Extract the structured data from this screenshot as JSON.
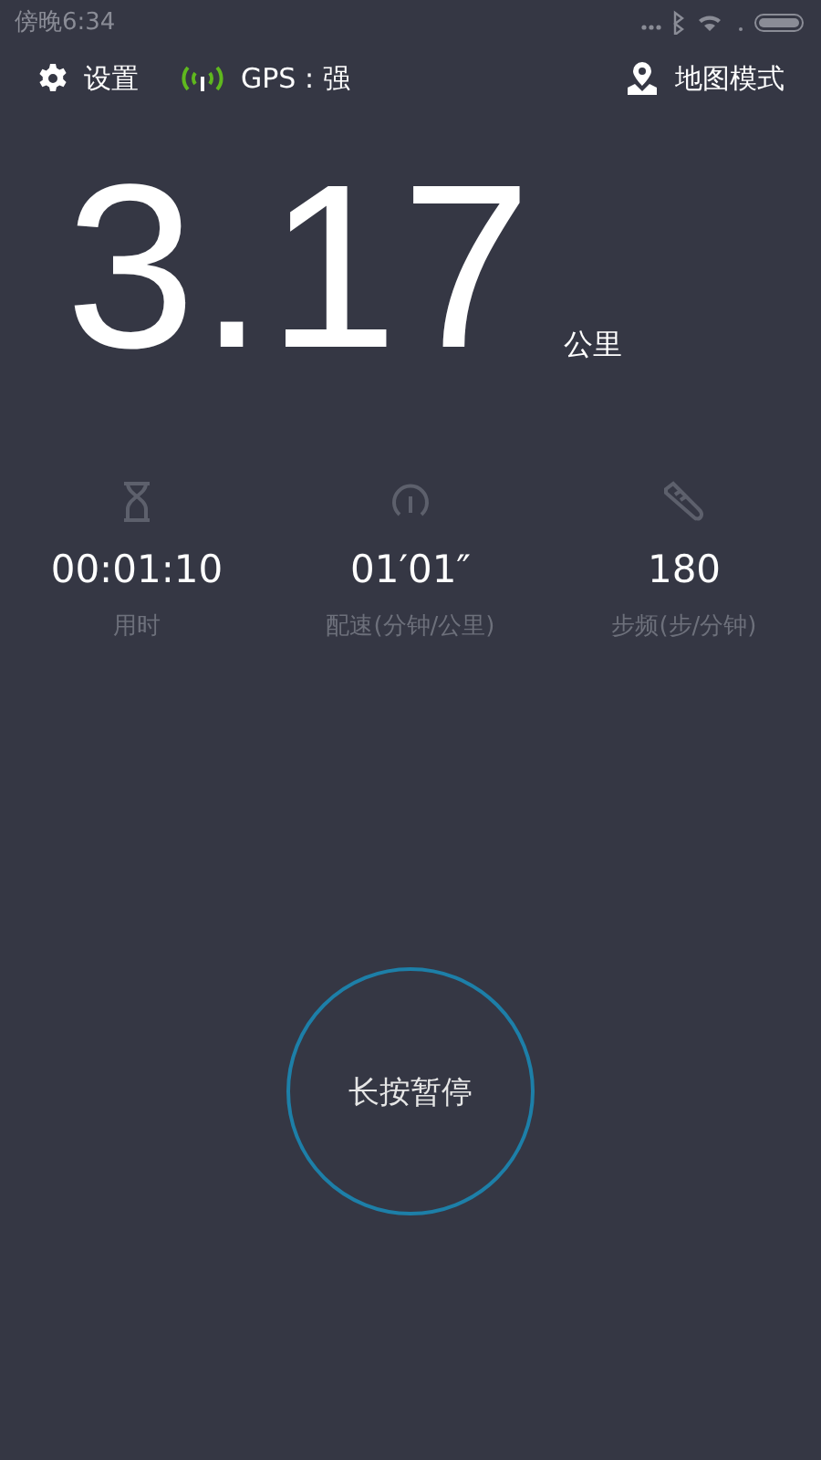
{
  "status_bar": {
    "time": "傍晚6:34"
  },
  "toolbar": {
    "settings": "设置",
    "gps": "GPS : 强",
    "map_mode": "地图模式"
  },
  "distance": {
    "value": "3.17",
    "unit": "公里"
  },
  "stats": [
    {
      "kind": "time",
      "value": "00:01:10",
      "label": "用时"
    },
    {
      "kind": "pace",
      "value": "01′01″",
      "label": "配速(分钟/公里)"
    },
    {
      "kind": "cadence",
      "value": "180",
      "label": "步频(步/分钟)"
    }
  ],
  "pause_button": "长按暂停"
}
